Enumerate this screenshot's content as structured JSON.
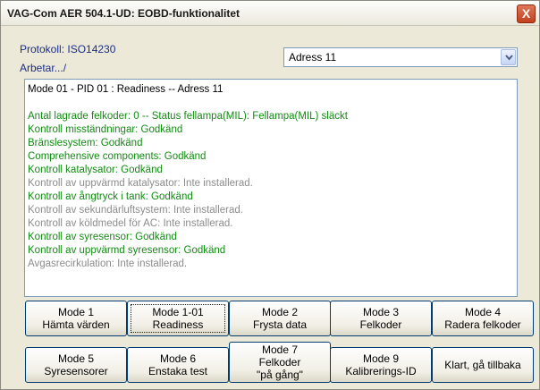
{
  "window": {
    "title": "VAG-Com AER 504.1-UD:  EOBD-funktionalitet",
    "close_glyph": "X"
  },
  "info": {
    "protocol": "Protokoll: ISO14230",
    "status": "Arbetar.../"
  },
  "address_select": {
    "value": "Adress 11"
  },
  "output": {
    "header": "Mode 01 - PID 01 : Readiness  --  Adress 11",
    "lines": [
      {
        "text": "Antal lagrade felkoder: 0  --  Status fellampa(MIL): Fellampa(MIL) släckt",
        "status": "ok"
      },
      {
        "text": "Kontroll misständningar:  Godkänd",
        "status": "ok"
      },
      {
        "text": "Bränslesystem:  Godkänd",
        "status": "ok"
      },
      {
        "text": "Comprehensive components:  Godkänd",
        "status": "ok"
      },
      {
        "text": "Kontroll katalysator:  Godkänd",
        "status": "ok"
      },
      {
        "text": "Kontroll av uppvärmd katalysator: Inte installerad.",
        "status": "na"
      },
      {
        "text": "Kontroll av ångtryck i tank:  Godkänd",
        "status": "ok"
      },
      {
        "text": "Kontroll av sekundärluftsystem: Inte installerad.",
        "status": "na"
      },
      {
        "text": "Kontroll av köldmedel för AC: Inte installerad.",
        "status": "na"
      },
      {
        "text": "Kontroll av syresensor:  Godkänd",
        "status": "ok"
      },
      {
        "text": "Kontroll av uppvärmd syresensor:  Godkänd",
        "status": "ok"
      },
      {
        "text": "Avgasrecirkulation: Inte installerad.",
        "status": "na"
      }
    ]
  },
  "buttons": {
    "mode1": {
      "l1": "Mode 1",
      "l2": "Hämta värden"
    },
    "mode1_01": {
      "l1": "Mode 1-01",
      "l2": "Readiness"
    },
    "mode2": {
      "l1": "Mode 2",
      "l2": "Frysta data"
    },
    "mode3": {
      "l1": "Mode 3",
      "l2": "Felkoder"
    },
    "mode4": {
      "l1": "Mode 4",
      "l2": "Radera felkoder"
    },
    "mode5": {
      "l1": "Mode 5",
      "l2": "Syresensorer"
    },
    "mode6": {
      "l1": "Mode 6",
      "l2": "Enstaka test"
    },
    "mode7": {
      "l1": "Mode 7",
      "l2": "Felkoder",
      "l3": "\"på gång\""
    },
    "mode9": {
      "l1": "Mode 9",
      "l2": "Kalibrerings-ID"
    },
    "done": {
      "l1": "Klart, gå tillbaka"
    }
  }
}
